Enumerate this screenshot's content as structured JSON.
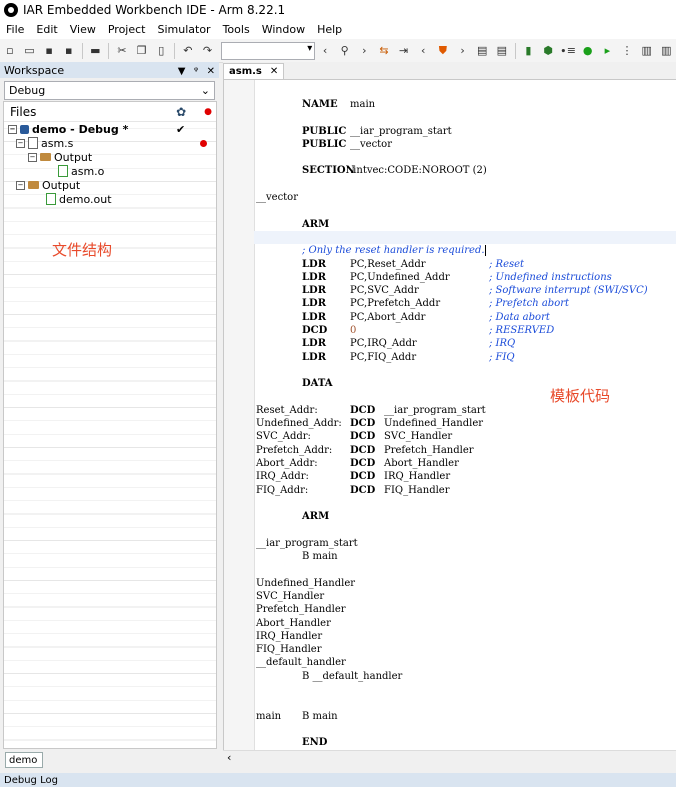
{
  "window": {
    "title": "IAR Embedded Workbench IDE - Arm 8.22.1"
  },
  "menu": [
    "File",
    "Edit",
    "View",
    "Project",
    "Simulator",
    "Tools",
    "Window",
    "Help"
  ],
  "workspace": {
    "header": "Workspace",
    "header_controls": [
      "▼",
      "ᵠ",
      "✕"
    ],
    "config": "Debug",
    "files_header": "Files",
    "tree": {
      "project": "demo - Debug *",
      "asm_file": "asm.s",
      "output1": "Output",
      "obj_file": "asm.o",
      "output2": "Output",
      "out_file": "demo.out"
    },
    "tab": "demo",
    "annotation": "文件结构"
  },
  "editor": {
    "tab_label": "asm.s",
    "tab_close": "✕",
    "annotation": "模板代码",
    "lines": [
      [
        "",
        "NAME",
        "main",
        "",
        ""
      ],
      [
        "",
        "",
        "",
        "",
        ""
      ],
      [
        "",
        "PUBLIC",
        "__iar_program_start",
        "",
        ""
      ],
      [
        "",
        "PUBLIC",
        "__vector",
        "",
        ""
      ],
      [
        "",
        "",
        "",
        "",
        ""
      ],
      [
        "",
        "SECTION",
        ".intvec:CODE:NOROOT (2)",
        "",
        ""
      ],
      [
        "",
        "",
        "",
        "",
        ""
      ],
      [
        "__vector",
        "",
        "",
        "",
        ""
      ],
      [
        "",
        "",
        "",
        "",
        ""
      ],
      [
        "",
        "ARM",
        "",
        "",
        ""
      ],
      [
        "",
        "",
        "",
        "",
        ""
      ],
      [
        "",
        "; Only the reset handler is required.",
        "",
        "",
        ""
      ],
      [
        "",
        "LDR",
        "PC,Reset_Addr",
        "",
        "; Reset"
      ],
      [
        "",
        "LDR",
        "PC,Undefined_Addr",
        "",
        "; Undefined instructions"
      ],
      [
        "",
        "LDR",
        "PC,SVC_Addr",
        "",
        "; Software interrupt (SWI/SVC)"
      ],
      [
        "",
        "LDR",
        "PC,Prefetch_Addr",
        "",
        "; Prefetch abort"
      ],
      [
        "",
        "LDR",
        "PC,Abort_Addr",
        "",
        "; Data abort"
      ],
      [
        "",
        "DCD",
        "0",
        "",
        "; RESERVED"
      ],
      [
        "",
        "LDR",
        "PC,IRQ_Addr",
        "",
        "; IRQ"
      ],
      [
        "",
        "LDR",
        "PC,FIQ_Addr",
        "",
        "; FIQ"
      ],
      [
        "",
        "",
        "",
        "",
        ""
      ],
      [
        "",
        "DATA",
        "",
        "",
        ""
      ],
      [
        "",
        "",
        "",
        "",
        ""
      ],
      [
        "Reset_Addr:",
        "",
        "DCD",
        "__iar_program_start",
        ""
      ],
      [
        "Undefined_Addr:",
        "",
        "DCD",
        "Undefined_Handler",
        ""
      ],
      [
        "SVC_Addr:",
        "",
        "DCD",
        "SVC_Handler",
        ""
      ],
      [
        "Prefetch_Addr:",
        "",
        "DCD",
        "Prefetch_Handler",
        ""
      ],
      [
        "Abort_Addr:",
        "",
        "DCD",
        "Abort_Handler",
        ""
      ],
      [
        "IRQ_Addr:",
        "",
        "DCD",
        "IRQ_Handler",
        ""
      ],
      [
        "FIQ_Addr:",
        "",
        "DCD",
        "FIQ_Handler",
        ""
      ],
      [
        "",
        "",
        "",
        "",
        ""
      ],
      [
        "",
        "ARM",
        "",
        "",
        ""
      ],
      [
        "",
        "",
        "",
        "",
        ""
      ],
      [
        "__iar_program_start",
        "",
        "",
        "",
        ""
      ],
      [
        "",
        "B main",
        "",
        "",
        ""
      ],
      [
        "",
        "",
        "",
        "",
        ""
      ],
      [
        "Undefined_Handler",
        "",
        "",
        "",
        ""
      ],
      [
        "SVC_Handler",
        "",
        "",
        "",
        ""
      ],
      [
        "Prefetch_Handler",
        "",
        "",
        "",
        ""
      ],
      [
        "Abort_Handler",
        "",
        "",
        "",
        ""
      ],
      [
        "IRQ_Handler",
        "",
        "",
        "",
        ""
      ],
      [
        "FIQ_Handler",
        "",
        "",
        "",
        ""
      ],
      [
        "__default_handler",
        "",
        "",
        "",
        ""
      ],
      [
        "",
        "B __default_handler",
        "",
        "",
        ""
      ],
      [
        "",
        "",
        "",
        "",
        ""
      ],
      [
        "",
        "",
        "",
        "",
        ""
      ],
      [
        "main",
        "B main",
        "",
        "",
        ""
      ],
      [
        "",
        "",
        "",
        "",
        ""
      ],
      [
        "",
        "END",
        "",
        "",
        ""
      ]
    ]
  },
  "status": {
    "panel": "Debug Log"
  }
}
